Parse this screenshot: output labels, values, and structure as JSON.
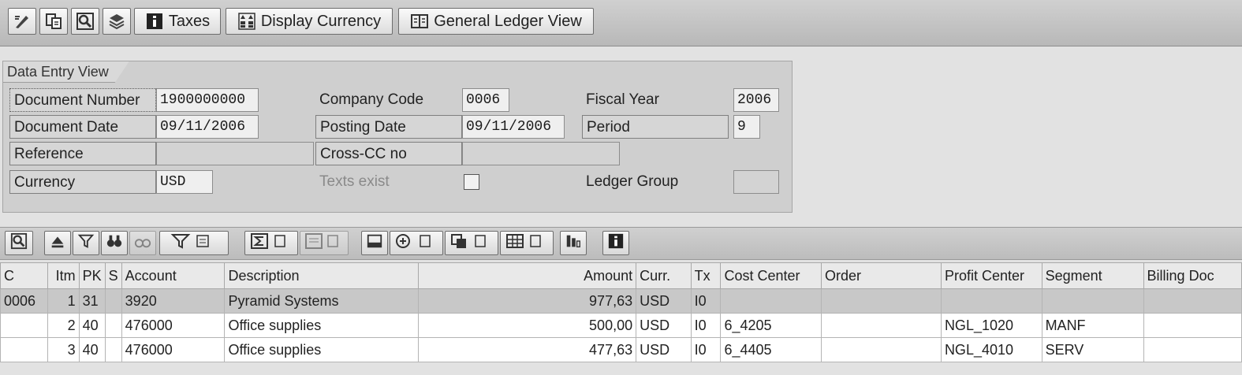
{
  "toolbar": {
    "taxes_label": "Taxes",
    "display_currency_label": "Display Currency",
    "general_ledger_view_label": "General Ledger View"
  },
  "header": {
    "title": "Data Entry View",
    "document_number": {
      "label": "Document Number",
      "value": "1900000000"
    },
    "company_code": {
      "label": "Company Code",
      "value": "0006"
    },
    "fiscal_year": {
      "label": "Fiscal Year",
      "value": "2006"
    },
    "document_date": {
      "label": "Document Date",
      "value": "09/11/2006"
    },
    "posting_date": {
      "label": "Posting Date",
      "value": "09/11/2006"
    },
    "period": {
      "label": "Period",
      "value": "9"
    },
    "reference": {
      "label": "Reference",
      "value": ""
    },
    "cross_cc": {
      "label": "Cross-CC no",
      "value": ""
    },
    "currency": {
      "label": "Currency",
      "value": "USD"
    },
    "texts_exist": {
      "label": "Texts exist",
      "checked": false
    },
    "ledger_group": {
      "label": "Ledger Group",
      "value": ""
    }
  },
  "grid": {
    "columns": {
      "c": "C",
      "itm": "Itm",
      "pk": "PK",
      "s": "S",
      "account": "Account",
      "description": "Description",
      "amount": "Amount",
      "curr": "Curr.",
      "tx": "Tx",
      "cost_center": "Cost Center",
      "order": "Order",
      "profit_center": "Profit Center",
      "segment": "Segment",
      "billing_doc": "Billing Doc"
    },
    "rows": [
      {
        "c": "0006",
        "itm": "1",
        "pk": "31",
        "s": "",
        "account": "3920",
        "description": "Pyramid Systems",
        "amount": "977,63",
        "curr": "USD",
        "tx": "I0",
        "cost_center": "",
        "order": "",
        "profit_center": "",
        "segment": "",
        "billing_doc": ""
      },
      {
        "c": "",
        "itm": "2",
        "pk": "40",
        "s": "",
        "account": "476000",
        "description": "Office supplies",
        "amount": "500,00",
        "curr": "USD",
        "tx": "I0",
        "cost_center": "6_4205",
        "order": "",
        "profit_center": "NGL_1020",
        "segment": "MANF",
        "billing_doc": ""
      },
      {
        "c": "",
        "itm": "3",
        "pk": "40",
        "s": "",
        "account": "476000",
        "description": "Office supplies",
        "amount": "477,63",
        "curr": "USD",
        "tx": "I0",
        "cost_center": "6_4405",
        "order": "",
        "profit_center": "NGL_4010",
        "segment": "SERV",
        "billing_doc": ""
      }
    ]
  }
}
